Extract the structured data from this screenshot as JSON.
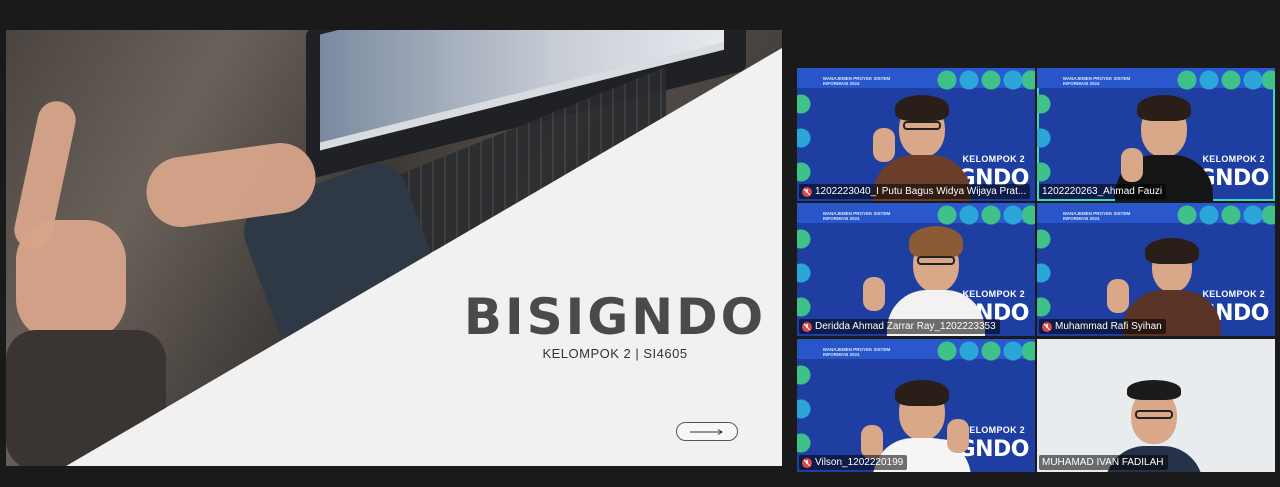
{
  "slide": {
    "title": "BISIGNDO",
    "subtitle": "KELOMPOK 2 | SI4605",
    "next_icon": "long-arrow-right-icon"
  },
  "participants": [
    {
      "name": "1202223040_I Putu Bagus Widya Wijaya Prat...",
      "muted": true,
      "active": false,
      "bg": "event"
    },
    {
      "name": "1202220263_Ahmad Fauzi",
      "muted": false,
      "active": true,
      "bg": "event"
    },
    {
      "name": "Deridda Ahmad Zarrar Ray_1202223353",
      "muted": true,
      "active": false,
      "bg": "event"
    },
    {
      "name": "Muhammad Rafi Syihan",
      "muted": true,
      "active": false,
      "bg": "event"
    },
    {
      "name": "Vilson_1202220199",
      "muted": true,
      "active": false,
      "bg": "event"
    },
    {
      "name": "MUHAMAD IVAN FADILAH",
      "muted": false,
      "active": false,
      "bg": "plain"
    }
  ],
  "virtual_bg": {
    "header": "MANAJEMEN PROYEK SISTEM INFORMASI 2024",
    "group": "KELOMPOK 2",
    "brand": "SIGNDO"
  },
  "colors": {
    "app_bg": "#1a1a1a",
    "active_border": "#3dd6c0",
    "virtual_bg_blue": "#1e3fa1",
    "muted_mic": "#e04848"
  }
}
